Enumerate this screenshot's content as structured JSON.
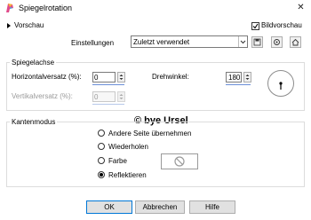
{
  "window": {
    "title": "Spiegelrotation",
    "close_glyph": "✕"
  },
  "preview": {
    "toggle_label": "Vorschau",
    "checkbox_label": "Bildvorschau",
    "checked": true
  },
  "settings": {
    "label": "Einstellungen",
    "value": "Zuletzt verwendet"
  },
  "mirror_axis": {
    "title": "Spiegelachse",
    "horizontal_offset": {
      "label": "Horizontalversatz (%):",
      "value": "0"
    },
    "vertical_offset": {
      "label": "Vertikalversatz (%):",
      "value": "0"
    },
    "angle": {
      "label": "Drehwinkel:",
      "value": "180"
    }
  },
  "watermark": "© bye Ursel",
  "edge_mode": {
    "title": "Kantenmodus",
    "options": [
      {
        "label": "Andere Seite übernehmen",
        "selected": false
      },
      {
        "label": "Wiederholen",
        "selected": false
      },
      {
        "label": "Farbe",
        "selected": false
      },
      {
        "label": "Reflektieren",
        "selected": true
      }
    ]
  },
  "buttons": {
    "ok": "OK",
    "cancel": "Abbrechen",
    "help": "Hilfe"
  },
  "colors": {
    "accent": "#0078d7",
    "slider": "#6b8fd8"
  }
}
